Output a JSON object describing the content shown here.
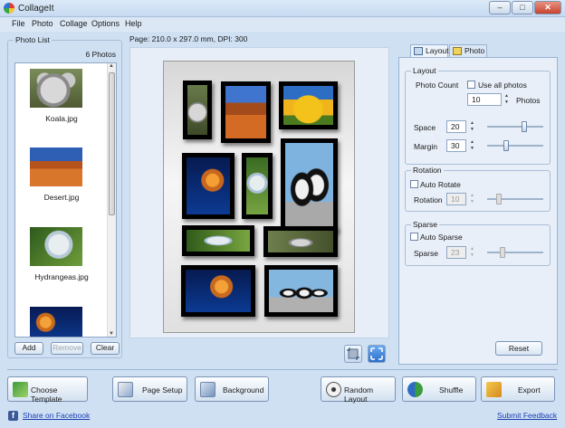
{
  "window": {
    "title": "CollageIt",
    "min": "–",
    "max": "□",
    "close": "✕"
  },
  "menu": [
    "File",
    "Photo",
    "Collage",
    "Options",
    "Help"
  ],
  "page_info": "Page: 210.0 x 297.0 mm, DPI: 300",
  "photo_list": {
    "title": "Photo List",
    "count": "6 Photos",
    "items": [
      {
        "label": "Koala.jpg",
        "icon": "koala-photo"
      },
      {
        "label": "Desert.jpg",
        "icon": "desert-photo"
      },
      {
        "label": "Hydrangeas.jpg",
        "icon": "hydrangeas-photo"
      },
      {
        "label": "",
        "icon": "jellyfish-photo"
      }
    ],
    "buttons": {
      "add": "Add",
      "remove": "Remove",
      "clear": "Clear"
    }
  },
  "tabs": {
    "layout": "Layout",
    "photo": "Photo"
  },
  "layout": {
    "title": "Layout",
    "photo_count_label": "Photo Count",
    "use_all_label": "Use all photos",
    "photo_count_value": "10",
    "photos_unit": "Photos",
    "space_label": "Space",
    "space_value": "20",
    "margin_label": "Margin",
    "margin_value": "30"
  },
  "rotation": {
    "title": "Rotation",
    "auto_label": "Auto Rotate",
    "label": "Rotation",
    "value": "10"
  },
  "sparse": {
    "title": "Sparse",
    "auto_label": "Auto Sparse",
    "label": "Sparse",
    "value": "23"
  },
  "reset_label": "Reset",
  "bottom": {
    "choose_template": "Choose Template",
    "page_setup": "Page Setup",
    "background": "Background",
    "random_layout": "Random Layout",
    "shuffle": "Shuffle",
    "export": "Export"
  },
  "links": {
    "facebook": "Share on Facebook",
    "feedback": "Submit Feedback"
  }
}
